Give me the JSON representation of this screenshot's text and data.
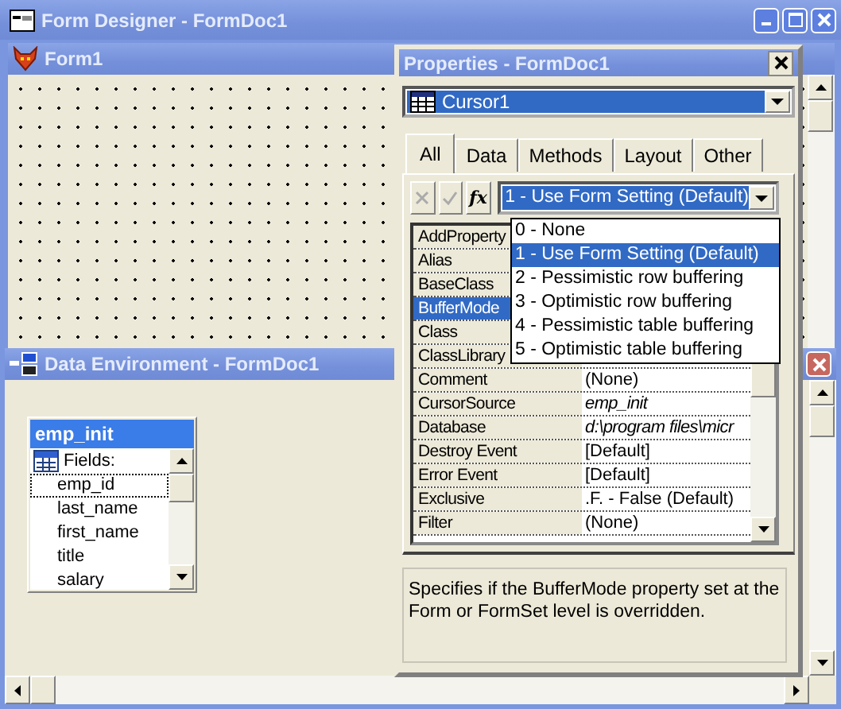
{
  "window": {
    "title": "Form Designer - FormDoc1"
  },
  "form_window": {
    "title": "Form1"
  },
  "data_environment": {
    "title": "Data Environment - FormDoc1",
    "table": {
      "name": "emp_init",
      "fields_label": "Fields:",
      "fields": [
        {
          "name": "emp_id",
          "selected": true
        },
        {
          "name": "last_name",
          "selected": false
        },
        {
          "name": "first_name",
          "selected": false
        },
        {
          "name": "title",
          "selected": false
        },
        {
          "name": "salary",
          "selected": false
        }
      ]
    }
  },
  "properties": {
    "title": "Properties - FormDoc1",
    "object": "Cursor1",
    "tabs": [
      {
        "label": "All",
        "selected": true
      },
      {
        "label": "Data",
        "selected": false
      },
      {
        "label": "Methods",
        "selected": false
      },
      {
        "label": "Layout",
        "selected": false
      },
      {
        "label": "Other",
        "selected": false
      }
    ],
    "function_button": "fx",
    "value_combo": "1 - Use Form Setting (Default)",
    "rows": [
      {
        "name": "AddProperty",
        "selected": false
      },
      {
        "name": "Alias",
        "selected": false
      },
      {
        "name": "BaseClass",
        "selected": false
      },
      {
        "name": "BufferMode",
        "selected": true
      },
      {
        "name": "Class",
        "selected": false
      },
      {
        "name": "ClassLibrary",
        "selected": false
      },
      {
        "name": "Comment",
        "selected": false,
        "value": "(None)",
        "italic": false
      },
      {
        "name": "CursorSource",
        "selected": false,
        "value": "emp_init",
        "italic": true
      },
      {
        "name": "Database",
        "selected": false,
        "value": "d:\\program files\\micr",
        "italic": true
      },
      {
        "name": "Destroy Event",
        "selected": false,
        "value": "[Default]",
        "italic": false
      },
      {
        "name": "Error Event",
        "selected": false,
        "value": "[Default]",
        "italic": false
      },
      {
        "name": "Exclusive",
        "selected": false,
        "value": ".F. - False (Default)",
        "italic": false
      },
      {
        "name": "Filter",
        "selected": false,
        "value": "(None)",
        "italic": false
      }
    ],
    "dropdown": {
      "options": [
        {
          "label": "0 - None",
          "selected": false
        },
        {
          "label": "1 - Use Form Setting (Default)",
          "selected": true
        },
        {
          "label": "2 - Pessimistic row buffering",
          "selected": false
        },
        {
          "label": "3 - Optimistic row buffering",
          "selected": false
        },
        {
          "label": "4 - Pessimistic table buffering",
          "selected": false
        },
        {
          "label": "5 - Optimistic table buffering",
          "selected": false
        }
      ]
    },
    "description": "Specifies if the BufferMode property set at the Form or FormSet level is overridden."
  }
}
